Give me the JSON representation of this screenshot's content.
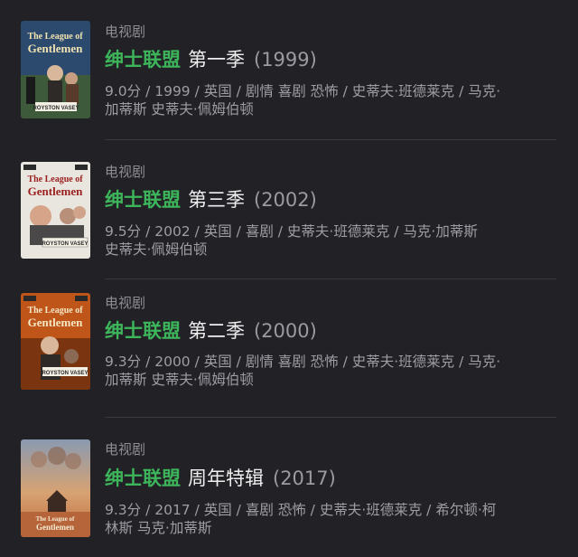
{
  "results": [
    {
      "type": "电视剧",
      "title_cn": "绅士联盟",
      "season": "第一季",
      "year": "(1999)",
      "meta_line1": "9.0分 / 1999 / 英国 / 剧情 喜剧 恐怖 / 史蒂夫·班德莱克 / 马克·",
      "meta_line2": "加蒂斯 史蒂夫·佩姆伯顿",
      "poster_text": "The League of Gentlemen",
      "poster_badge": "ROYSTON VASEY",
      "poster_color": "#2b4a6e"
    },
    {
      "type": "电视剧",
      "title_cn": "绅士联盟",
      "season": "第三季",
      "year": "(2002)",
      "meta_line1": "9.5分 / 2002 / 英国 / 喜剧 / 史蒂夫·班德莱克 / 马克·加蒂斯",
      "meta_line2": "史蒂夫·佩姆伯顿",
      "poster_text": "The League of Gentlemen",
      "poster_badge": "ROYSTON VASEY",
      "poster_color": "#e9e6df"
    },
    {
      "type": "电视剧",
      "title_cn": "绅士联盟",
      "season": "第二季",
      "year": "(2000)",
      "meta_line1": "9.3分 / 2000 / 英国 / 剧情 喜剧 恐怖 / 史蒂夫·班德莱克 / 马克·",
      "meta_line2": "加蒂斯 史蒂夫·佩姆伯顿",
      "poster_text": "The League of Gentlemen",
      "poster_badge": "ROYSTON VASEY",
      "poster_color": "#c0551a"
    },
    {
      "type": "电视剧",
      "title_cn": "绅士联盟",
      "season": "周年特辑",
      "year": "(2017)",
      "meta_line1": "9.3分 / 2017 / 英国 / 喜剧 恐怖 / 史蒂夫·班德莱克 / 希尔顿·柯",
      "meta_line2": "林斯 马克·加蒂斯",
      "poster_text": "The League of Gentlemen",
      "poster_badge": "",
      "poster_color": "#c9865a"
    }
  ],
  "colors": {
    "background": "#222126",
    "accent_green": "#3db55b",
    "divider": "#3a393f"
  }
}
